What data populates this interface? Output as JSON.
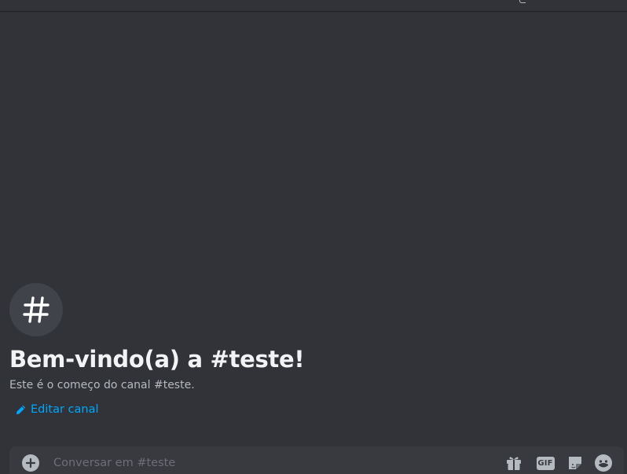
{
  "channel": {
    "welcome_title": "Bem-vindo(a) a #teste!",
    "welcome_subtitle": "Este é o começo do canal #teste.",
    "edit_label": "Editar canal",
    "icon": "hash-icon"
  },
  "composer": {
    "placeholder": "Conversar em #teste",
    "value": "",
    "gif_label": "GIF",
    "icons": [
      "add-circle-icon",
      "gift-icon",
      "gif-icon",
      "sticker-icon",
      "emoji-icon"
    ]
  },
  "colors": {
    "background": "#313338",
    "composer": "#383a40",
    "link": "#00a8fc",
    "heading": "#f2f3f5",
    "muted": "#b5bac1"
  }
}
